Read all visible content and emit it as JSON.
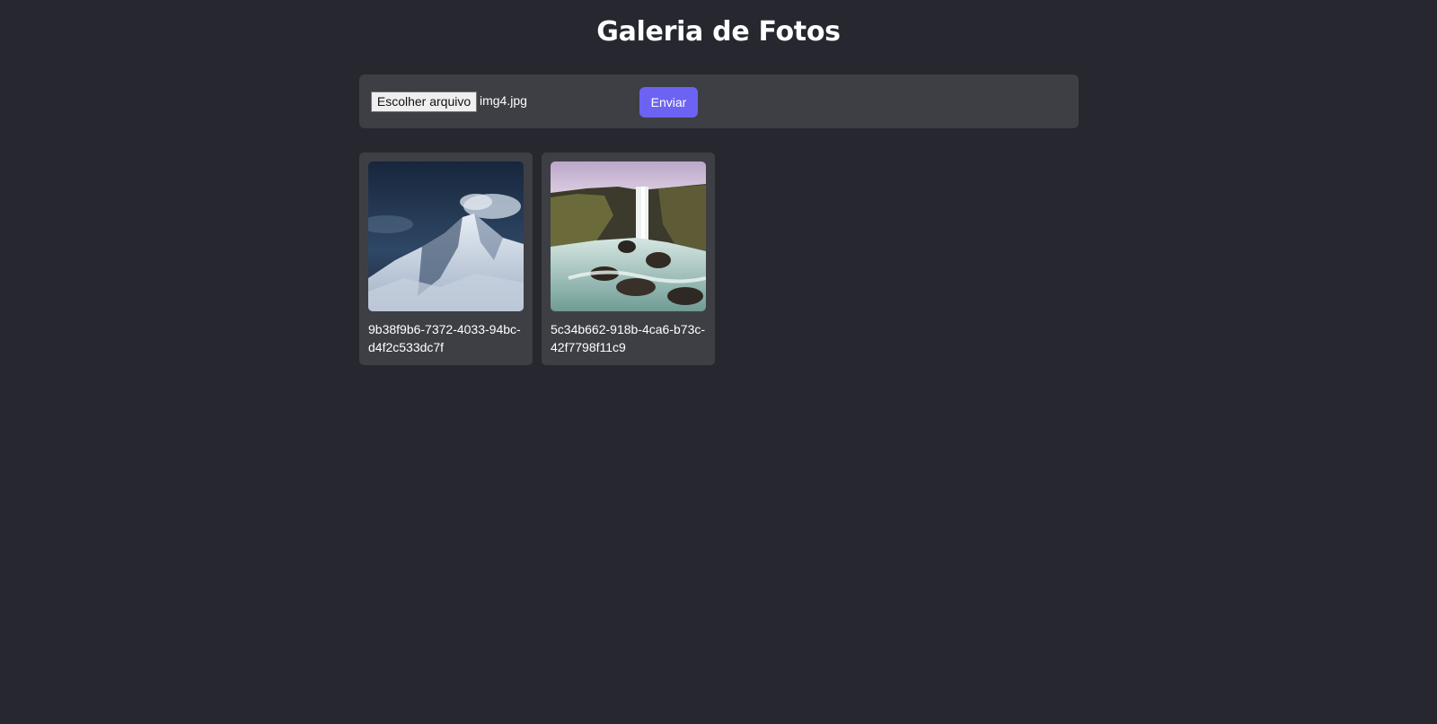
{
  "page": {
    "title": "Galeria de Fotos"
  },
  "upload": {
    "file_button_label": "Escolher arquivo",
    "file_name": "img4.jpg",
    "submit_label": "Enviar"
  },
  "gallery": {
    "items": [
      {
        "caption": "9b38f9b6-7372-4033-94bc-d4f2c533dc7f",
        "image": "snowy-mountain-photo"
      },
      {
        "caption": "5c34b662-918b-4ca6-b73c-42f7798f11c9",
        "image": "waterfall-photo"
      }
    ]
  },
  "colors": {
    "background": "#26272f",
    "panel": "#3e3f45",
    "accent": "#6c63f2"
  }
}
